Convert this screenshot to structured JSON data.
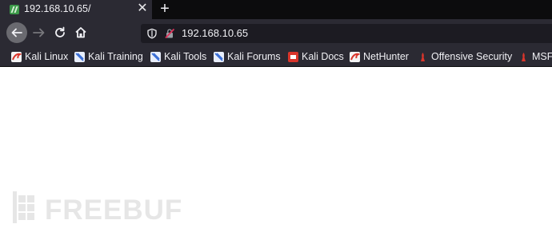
{
  "tab": {
    "title": "192.168.10.65/",
    "favicon": "kali-dragon-icon",
    "close_glyph": "✕",
    "new_tab_glyph": "+"
  },
  "toolbar": {
    "back_icon": "arrow-left-icon",
    "forward_icon": "arrow-right-icon",
    "reload_icon": "reload-icon",
    "home_icon": "home-icon",
    "url": "192.168.10.65"
  },
  "bookmarks": [
    {
      "label": "Kali Linux",
      "icon": "kali-red-icon"
    },
    {
      "label": "Kali Training",
      "icon": "kali-blue-icon"
    },
    {
      "label": "Kali Tools",
      "icon": "kali-blue-icon"
    },
    {
      "label": "Kali Forums",
      "icon": "kali-blue-icon"
    },
    {
      "label": "Kali Docs",
      "icon": "kali-docs-icon"
    },
    {
      "label": "NetHunter",
      "icon": "kali-red-icon"
    },
    {
      "label": "Offensive Security",
      "icon": "offsec-icon"
    },
    {
      "label": "MSF",
      "icon": "offsec-icon"
    }
  ],
  "watermark": {
    "text": "FREEBUF"
  },
  "colors": {
    "tabbar": "#0c0c0d",
    "toolbar": "#2b2a33",
    "urlbar": "#1c1b22",
    "text": "#f0f0f4",
    "kali_red": "#d9352b",
    "kali_blue": "#3b6fd6"
  }
}
